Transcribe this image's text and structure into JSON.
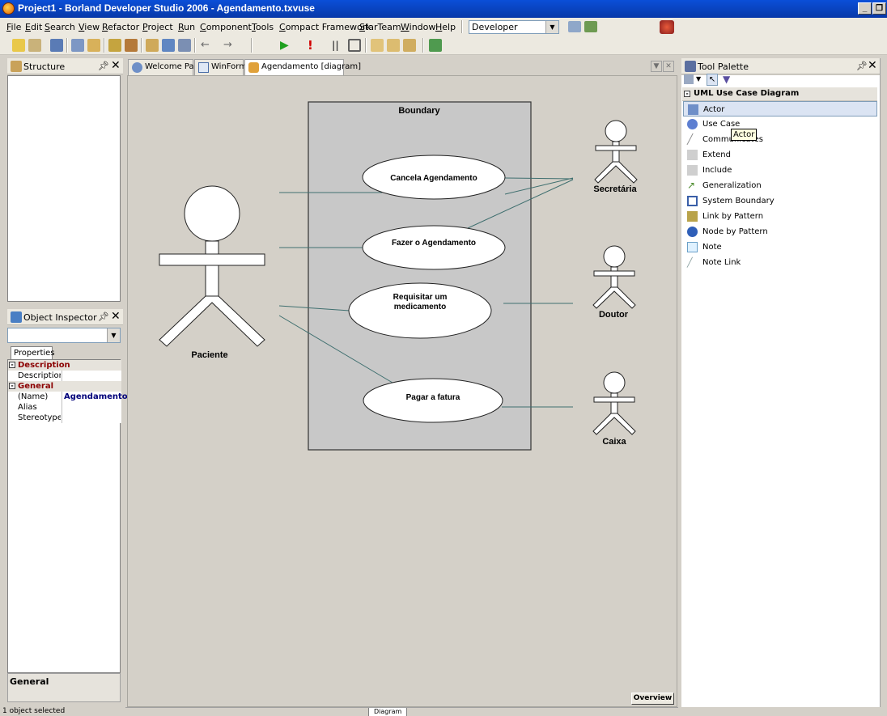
{
  "window": {
    "title": "Project1 - Borland Developer Studio 2006 - Agendamento.txvuse"
  },
  "menu": {
    "items": [
      "File",
      "Edit",
      "Search",
      "View",
      "Refactor",
      "Project",
      "Run",
      "Component",
      "Tools",
      "Compact Framework",
      "StarTeam",
      "Window",
      "Help"
    ],
    "layout_selector": "Developer"
  },
  "structure": {
    "title": "Structure"
  },
  "inspector": {
    "title": "Object Inspector",
    "tab": "Properties",
    "categories": [
      {
        "name": "Description",
        "rows": [
          {
            "name": "Description",
            "value": ""
          }
        ]
      },
      {
        "name": "General",
        "rows": [
          {
            "name": "(Name)",
            "value": "Agendamento"
          },
          {
            "name": "Alias",
            "value": ""
          },
          {
            "name": "Stereotype",
            "value": ""
          }
        ]
      }
    ],
    "help_title": "General"
  },
  "status": {
    "text": "1 object selected"
  },
  "tabs": [
    {
      "label": "Welcome Page",
      "icon": "globe-icon"
    },
    {
      "label": "WinForm",
      "icon": "form-icon"
    },
    {
      "label": "Agendamento [diagram]",
      "icon": "diagram-icon",
      "active": true
    }
  ],
  "diagram": {
    "boundary_label": "Boundary",
    "use_cases": [
      "Cancela Agendamento",
      "Fazer o Agendamento",
      "Requisitar um medicamento",
      "Pagar a fatura"
    ],
    "actors": [
      "Paciente",
      "Secretária",
      "Doutor",
      "Caixa"
    ],
    "overview_button": "Overview",
    "bottom_tab": "Diagram"
  },
  "palette": {
    "title": "Tool Palette",
    "category": "UML Use Case Diagram",
    "tooltip": "Actor",
    "items": [
      {
        "label": "Actor",
        "selected": true
      },
      {
        "label": "Use Case"
      },
      {
        "label": "Communicates"
      },
      {
        "label": "Extend"
      },
      {
        "label": "Include"
      },
      {
        "label": "Generalization"
      },
      {
        "label": "System Boundary"
      },
      {
        "label": "Link by Pattern"
      },
      {
        "label": "Node by Pattern"
      },
      {
        "label": "Note"
      },
      {
        "label": "Note Link"
      }
    ]
  },
  "colors": {
    "title_bar": "#0a4fd8",
    "selection": "#dbe4f3",
    "category_text": "#8b0000",
    "link_line": "#3f6f6f"
  }
}
